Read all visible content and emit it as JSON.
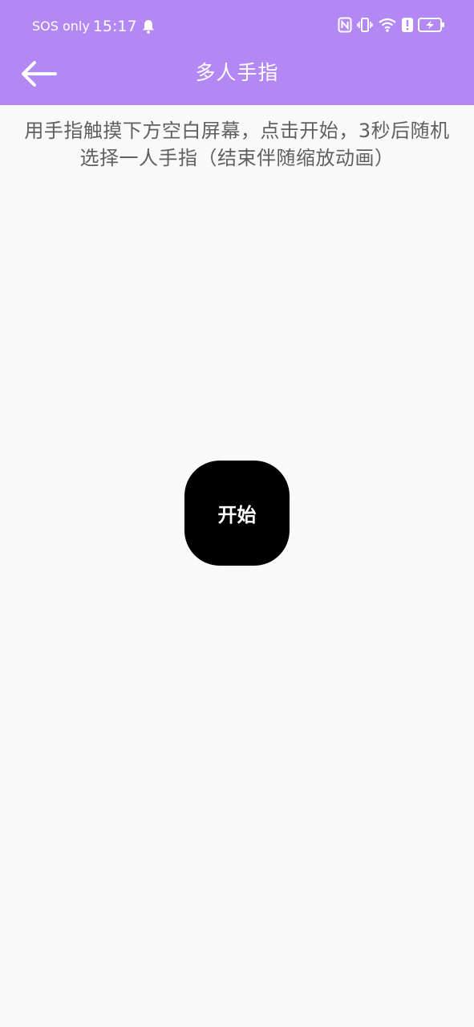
{
  "status_bar": {
    "carrier": "SOS only",
    "time": "15:17",
    "icons": [
      "bell-icon",
      "nfc-icon",
      "vibrate-icon",
      "wifi-icon",
      "alert-icon",
      "battery-charging-icon"
    ]
  },
  "app_bar": {
    "title": "多人手指",
    "back_icon": "arrow-left-icon",
    "color": "#b388f5"
  },
  "main": {
    "instruction": "用手指触摸下方空白屏幕，点击开始，3秒后随机选择一人手指（结束伴随缩放动画）",
    "start_label": "开始"
  }
}
